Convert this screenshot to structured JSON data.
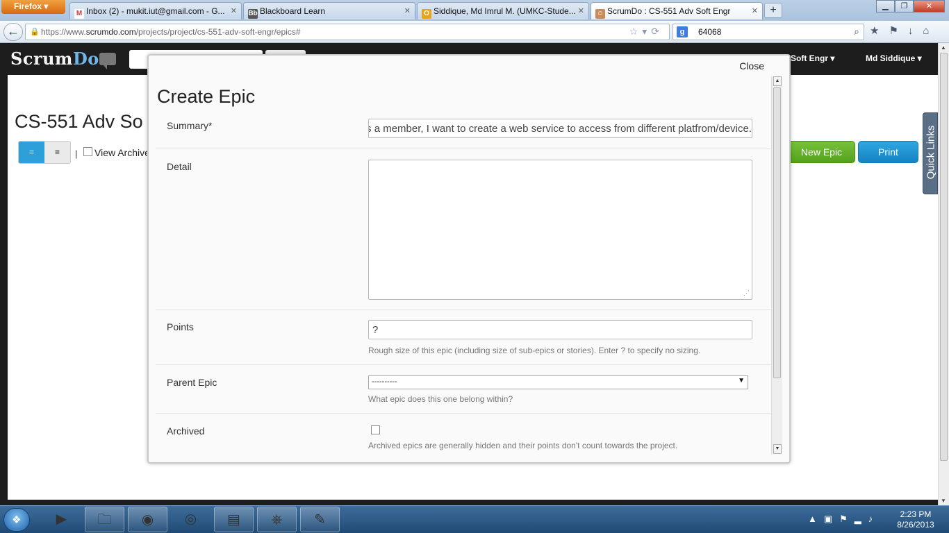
{
  "browser": {
    "menu_label": "Firefox",
    "tabs": [
      {
        "title": "Inbox (2) - mukit.iut@gmail.com - G...",
        "icon": "gmail-icon"
      },
      {
        "title": "Blackboard Learn",
        "icon": "blackboard-icon"
      },
      {
        "title": "Siddique, Md Imrul M. (UMKC-Stude...",
        "icon": "outlook-icon"
      },
      {
        "title": "ScrumDo : CS-551 Adv Soft Engr",
        "icon": "scrumdo-icon",
        "active": true
      }
    ],
    "url_prefix": "https://www.",
    "url_host": "scrumdo.com",
    "url_path": "/projects/project/cs-551-adv-soft-engr/epics#",
    "search_value": "64068"
  },
  "app": {
    "logo_main": "Scrum",
    "logo_accent": "Do",
    "project_menu": "v Soft Engr",
    "user_menu": "Md Siddique",
    "page_title": "CS-551 Adv So",
    "view_archived_label": "View Archive",
    "pipe": "|",
    "new_epic_label": "New Epic",
    "print_label": "Print",
    "quick_links_label": "Quick Links",
    "accent_color": "#2d9fd9",
    "new_epic_color": "#5fae28"
  },
  "modal": {
    "close_label": "Close",
    "title": "Create Epic",
    "summary_label": "Summary*",
    "summary_value": "As a member, I want to create a web service to access from different platfrom/device.",
    "detail_label": "Detail",
    "detail_value": "",
    "points_label": "Points",
    "points_value": "?",
    "points_help": "Rough size of this epic (including size of sub-epics or stories). Enter ? to specify no sizing.",
    "parent_label": "Parent Epic",
    "parent_value": "----------",
    "parent_help": "What epic does this one belong within?",
    "archived_label": "Archived",
    "archived_checked": false,
    "archived_help": "Archived epics are generally hidden and their points don't count towards the project."
  },
  "taskbar": {
    "time": "2:23 PM",
    "date": "8/26/2013"
  }
}
